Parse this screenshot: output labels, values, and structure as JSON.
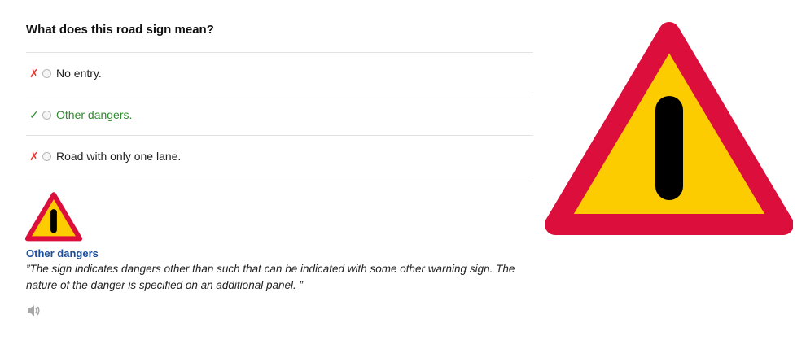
{
  "question": "What does this road sign mean?",
  "answers": [
    {
      "mark": "✗",
      "label": "No entry.",
      "status": "wrong"
    },
    {
      "mark": "✓",
      "label": "Other dangers.",
      "status": "correct"
    },
    {
      "mark": "✗",
      "label": "Road with only one lane.",
      "status": "wrong"
    }
  ],
  "explanation": {
    "title": "Other dangers",
    "text": "”The sign indicates dangers other than such that can be indicated with some other warning sign. The nature of the danger is specified on an additional panel. ”"
  },
  "icons": {
    "small_sign": "warning-triangle-other-dangers-icon",
    "big_sign": "warning-triangle-other-dangers-icon",
    "speaker": "speaker-icon"
  },
  "colors": {
    "sign_border": "#dc0f3c",
    "sign_fill": "#fccc00",
    "sign_bar": "#000000",
    "correct": "#2e8b2e",
    "wrong": "#e53935",
    "explanation_title": "#1a4d99"
  }
}
